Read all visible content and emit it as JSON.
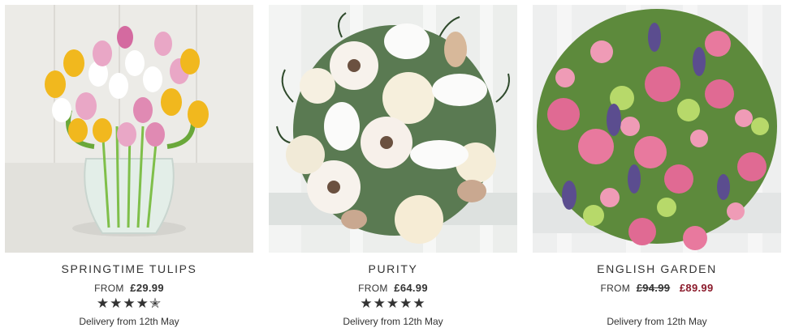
{
  "products": [
    {
      "name": "SPRINGTIME TULIPS",
      "from_label": "FROM",
      "price": "£29.99",
      "rating": 4.5,
      "rating_stars": "★★★★✭",
      "delivery": "Delivery from 12th May"
    },
    {
      "name": "PURITY",
      "from_label": "FROM",
      "price": "£64.99",
      "rating": 5,
      "rating_stars": "★★★★★",
      "delivery": "Delivery from 12th May"
    },
    {
      "name": "ENGLISH GARDEN",
      "from_label": "FROM",
      "old_price": "£94.99",
      "sale_price": "£89.99",
      "delivery": "Delivery from 12th May"
    }
  ],
  "colors": {
    "text": "#333333",
    "sale_price": "#8b1a2b"
  },
  "images": [
    "tulip-bouquet-in-glass-vase-photo",
    "white-rose-lily-gerbera-bouquet-photo",
    "pink-rose-lavender-garden-bouquet-photo"
  ]
}
